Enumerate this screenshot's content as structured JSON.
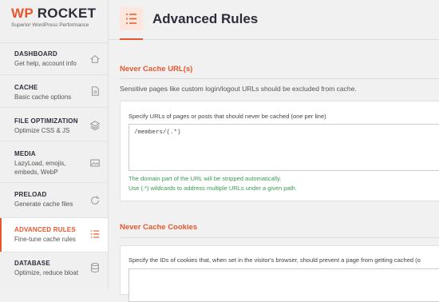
{
  "logo": {
    "wp": "WP",
    "rocket": "ROCKET",
    "tagline": "Superior WordPress Performance"
  },
  "sidebar": {
    "items": [
      {
        "title": "DASHBOARD",
        "desc": "Get help, account info",
        "icon": "home-icon"
      },
      {
        "title": "CACHE",
        "desc": "Basic cache options",
        "icon": "file-icon"
      },
      {
        "title": "FILE OPTIMIZATION",
        "desc": "Optimize CSS & JS",
        "icon": "layers-icon"
      },
      {
        "title": "MEDIA",
        "desc": "LazyLoad, emojis, embeds, WebP",
        "icon": "image-icon"
      },
      {
        "title": "PRELOAD",
        "desc": "Generate cache files",
        "icon": "refresh-icon"
      },
      {
        "title": "ADVANCED RULES",
        "desc": "Fine-tune cache rules",
        "icon": "list-icon",
        "active": true
      },
      {
        "title": "DATABASE",
        "desc": "Optimize, reduce bloat",
        "icon": "database-icon"
      }
    ]
  },
  "header": {
    "title": "Advanced Rules"
  },
  "never_cache_urls": {
    "title": "Never Cache URL(s)",
    "desc": "Sensitive pages like custom login/logout URLs should be excluded from cache.",
    "label": "Specify URLs of pages or posts that should never be cached (one per line)",
    "value": "/members/(.*)",
    "hint1": "The domain part of the URL will be stripped automatically.",
    "hint2": "Use (.*) wildcards to address multiple URLs under a given path."
  },
  "never_cache_cookies": {
    "title": "Never Cache Cookies",
    "label": "Specify the IDs of cookies that, when set in the visitor's browser, should prevent a page from getting cached (o"
  },
  "colors": {
    "accent": "#e8572c",
    "hint": "#3a9a54"
  }
}
